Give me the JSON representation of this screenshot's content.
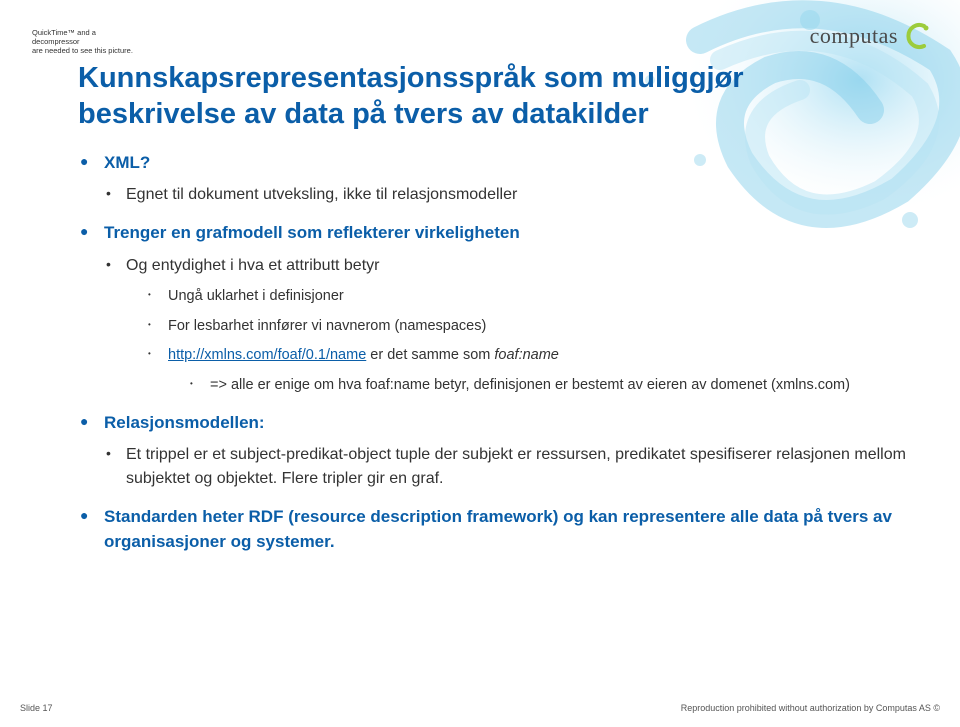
{
  "decompressor_note": {
    "line1": "QuickTime™ and a",
    "line2": "decompressor",
    "line3": "are needed to see this picture."
  },
  "logo": {
    "text": "computas"
  },
  "title": {
    "line1": "Kunnskapsrepresentasjonsspråk som muliggjør",
    "line2": "beskrivelse av data på tvers av datakilder"
  },
  "bullets": {
    "b1": "XML?",
    "b1_sub": "Egnet til dokument utveksling, ikke til relasjonsmodeller",
    "b2": "Trenger en grafmodell som reflekterer virkeligheten",
    "b2_s1": "Og entydighet i hva et attributt betyr",
    "b2_s1_a": "Ungå uklarhet i definisjoner",
    "b2_s1_b": "For lesbarhet innfører vi navnerom (namespaces)",
    "b2_s1_c_link": "http://xmlns.com/foaf/0.1/name",
    "b2_s1_c_rest": " er det samme som ",
    "b2_s1_c_em": "foaf:name",
    "b2_s1_c_sub": "=> alle er enige om hva foaf:name betyr, definisjonen er bestemt av eieren av domenet (xmlns.com)",
    "b3": "Relasjonsmodellen:",
    "b3_s1": "Et trippel er et subject-predikat-object tuple der subjekt er ressursen, predikatet spesifiserer relasjonen mellom subjektet og objektet. Flere tripler gir en graf.",
    "b4": "Standarden heter RDF (resource description framework) og kan representere alle data på tvers av organisasjoner og systemer."
  },
  "footer": {
    "left": "Slide 17",
    "right": "Reproduction prohibited without authorization by Computas AS ©"
  }
}
